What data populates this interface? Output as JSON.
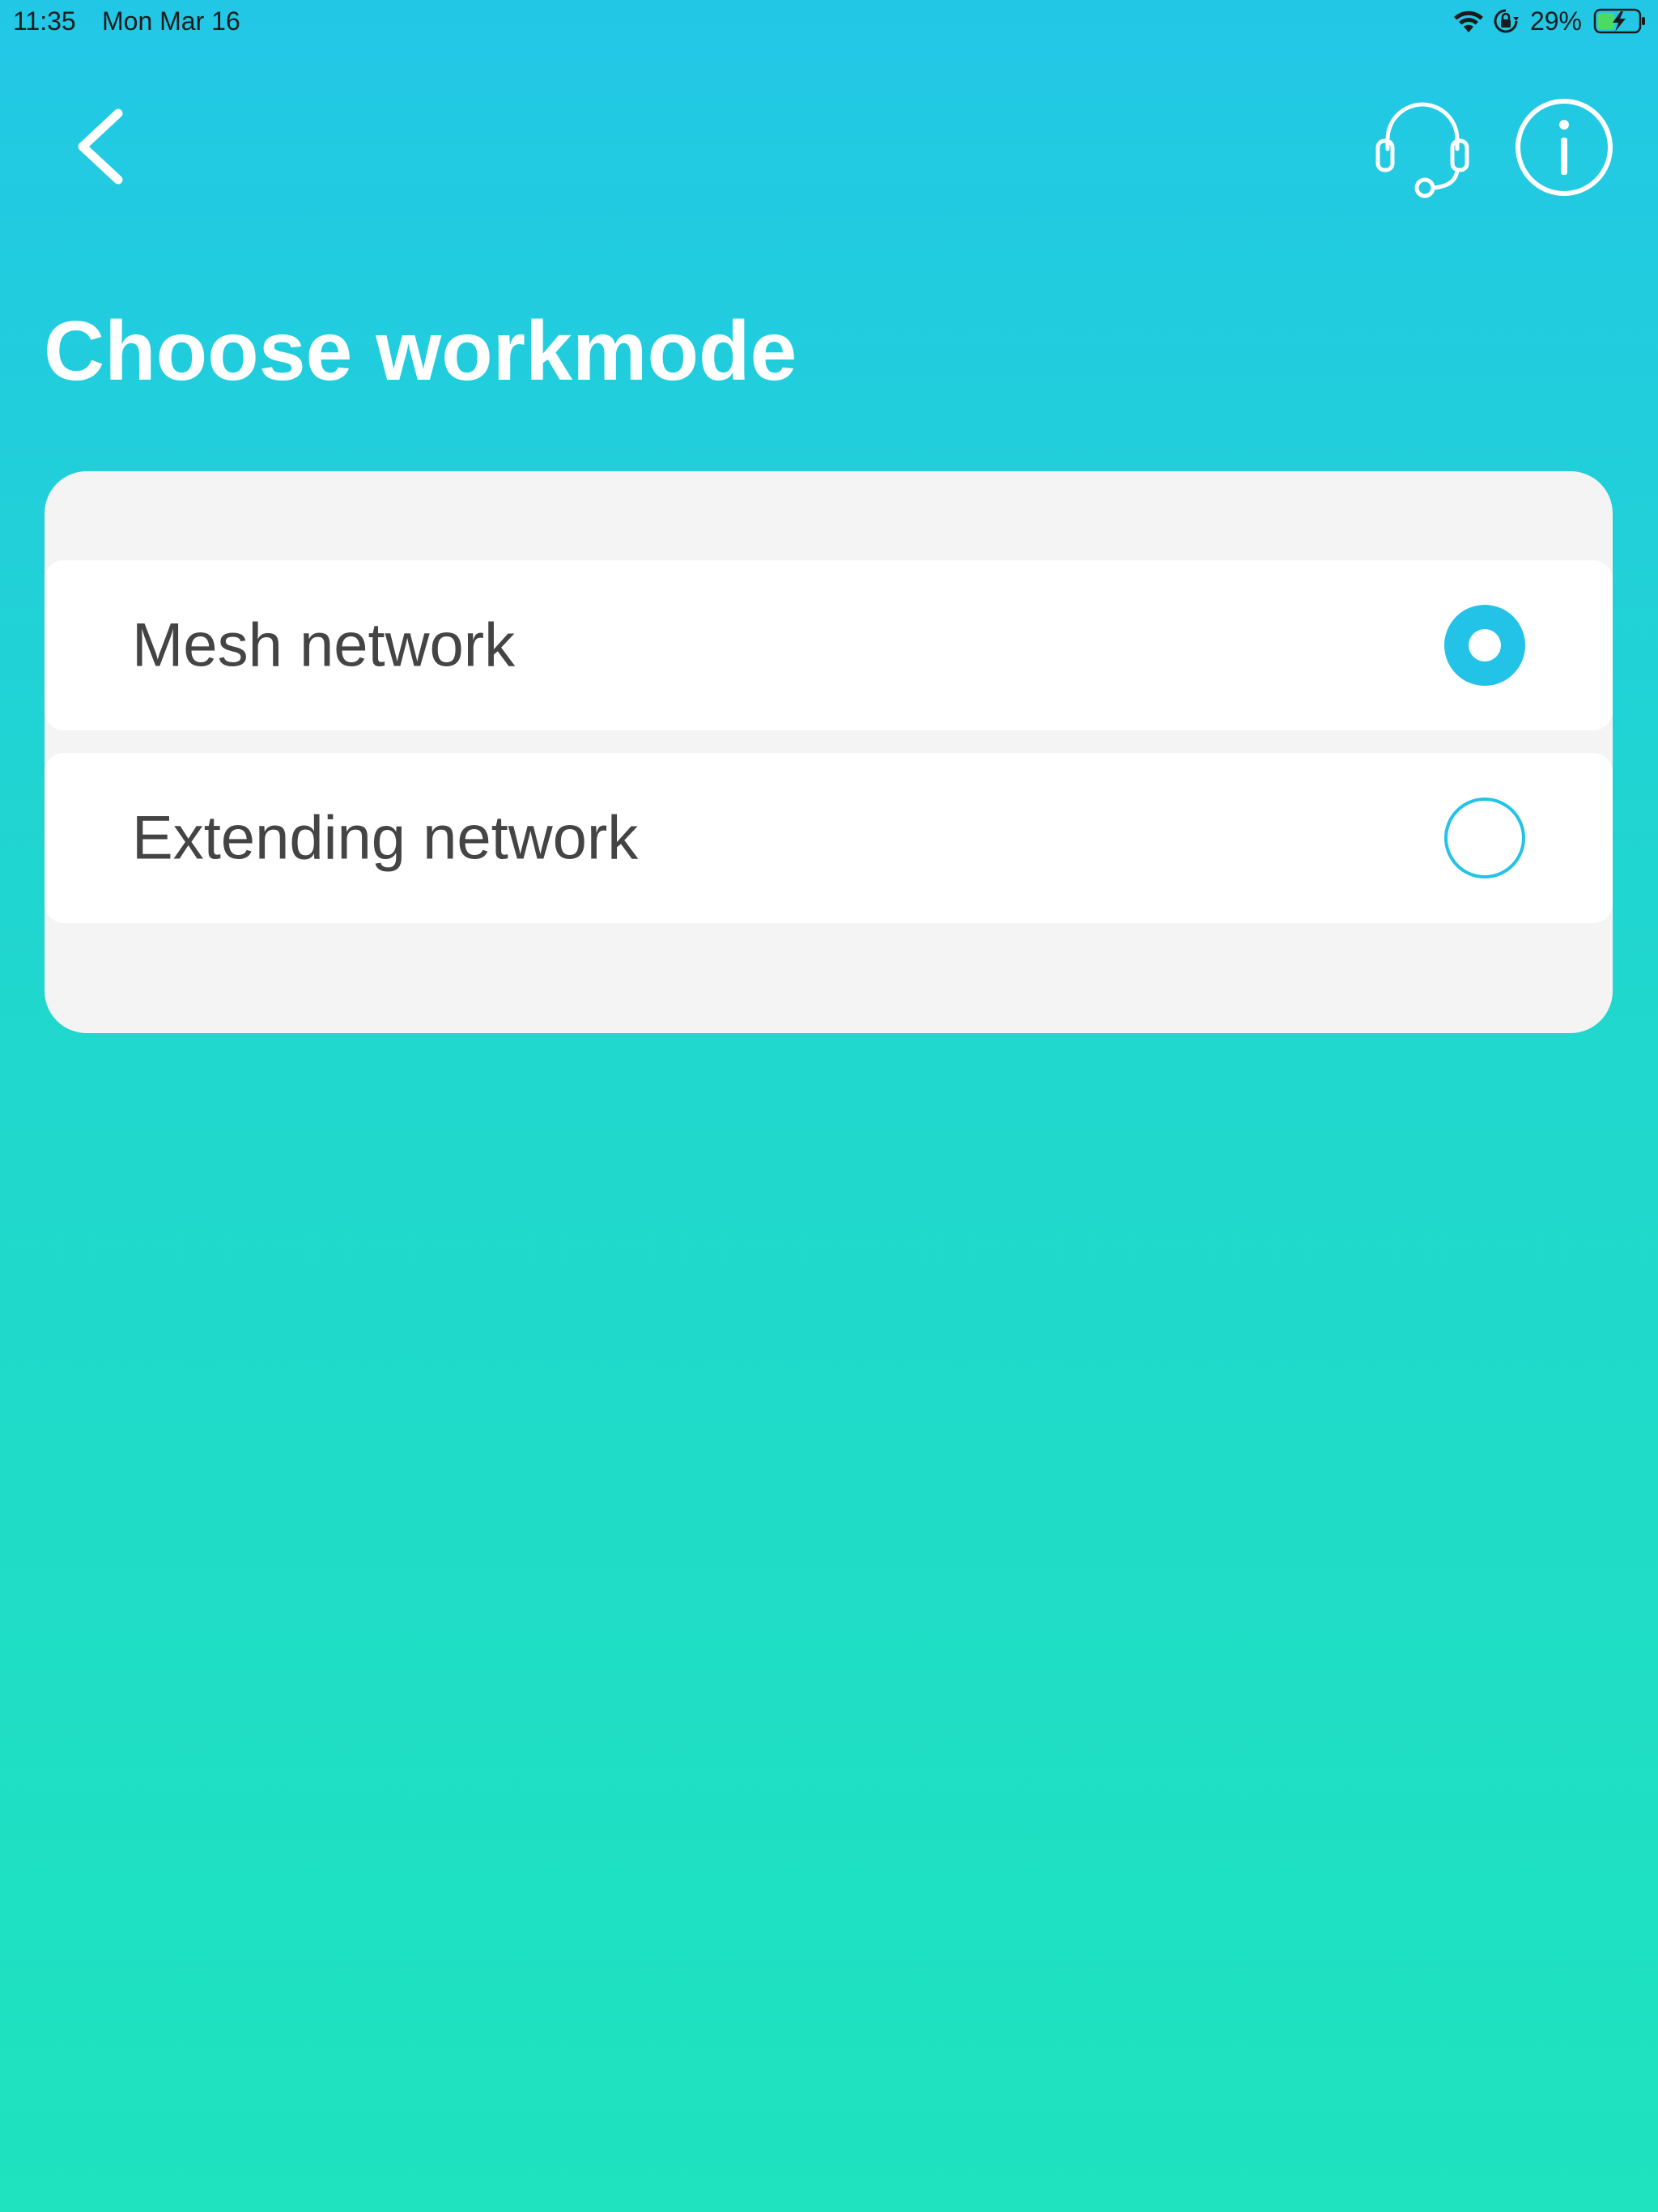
{
  "status_bar": {
    "time": "11:35",
    "date": "Mon Mar 16",
    "battery_percent": "29%",
    "icons": [
      "wifi-icon",
      "orientation-lock-icon",
      "battery-charging-icon"
    ]
  },
  "header": {
    "back_icon": "chevron-left-icon",
    "support_icon": "headset-icon",
    "info_icon": "info-icon",
    "title": "Choose workmode"
  },
  "options": [
    {
      "label": "Mesh network",
      "selected": true
    },
    {
      "label": "Extending network",
      "selected": false
    }
  ],
  "colors": {
    "accent": "#22C3E6",
    "gradient_top": "#22C7E6",
    "gradient_bottom": "#1EE3BE",
    "card_background": "#F4F4F4",
    "option_text": "#444444",
    "battery_green": "#4CD964"
  }
}
